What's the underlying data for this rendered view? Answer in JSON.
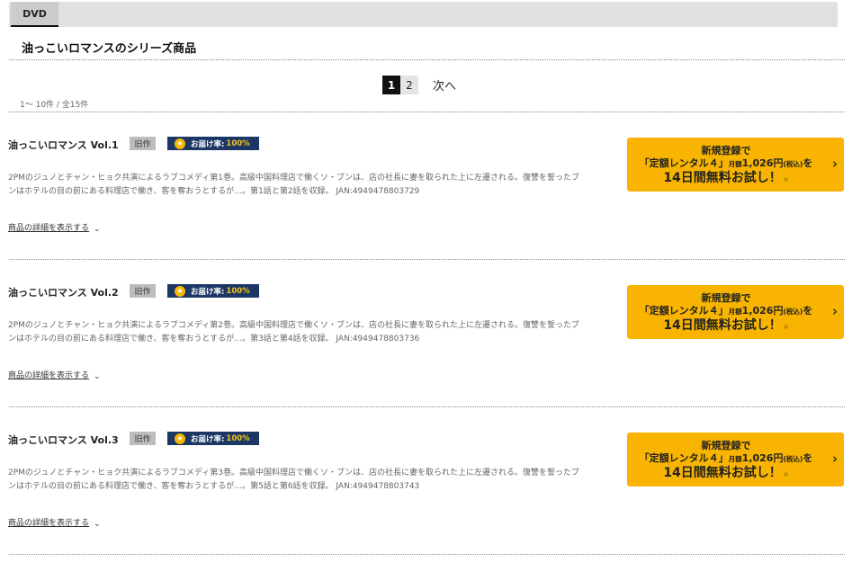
{
  "tabs": [
    {
      "label": "DVD"
    }
  ],
  "series_title": "油っこいロマンスのシリーズ商品",
  "pagination": {
    "pages": [
      "1",
      "2"
    ],
    "current": "1",
    "next_label": "次へ"
  },
  "result_count": "1～ 10件 / 全15件",
  "items": [
    {
      "title": "油っこいロマンス Vol.1",
      "badge_old": "旧作",
      "badge_rate_label": "お届け率:",
      "badge_rate_value": "100%",
      "description_line1": "2PMのジュノとチャン・ヒョク共演によるラブコメディ第1巻。高級中国料理店で働くソ・ブンは、店の社長に妻を取られた上に左遷される。復讐を誓ったブ",
      "description_line2": "ンはホテルの目の前にある料理店で働き、客を奪おうとするが…。第1話と第2話を収録。 JAN:4949478803729",
      "detail_link": "商品の詳細を表示する"
    },
    {
      "title": "油っこいロマンス Vol.2",
      "badge_old": "旧作",
      "badge_rate_label": "お届け率:",
      "badge_rate_value": "100%",
      "description_line1": "2PMのジュノとチャン・ヒョク共演によるラブコメディ第2巻。高級中国料理店で働くソ・ブンは、店の社長に妻を取られた上に左遷される。復讐を誓ったブ",
      "description_line2": "ンはホテルの目の前にある料理店で働き、客を奪おうとするが…。第3話と第4話を収録。 JAN:4949478803736",
      "detail_link": "商品の詳細を表示する"
    },
    {
      "title": "油っこいロマンス Vol.3",
      "badge_old": "旧作",
      "badge_rate_label": "お届け率:",
      "badge_rate_value": "100%",
      "description_line1": "2PMのジュノとチャン・ヒョク共演によるラブコメディ第3巻。高級中国料理店で働くソ・ブンは、店の社長に妻を取られた上に左遷される。復讐を誓ったブ",
      "description_line2": "ンはホテルの目の前にある料理店で働き、客を奪おうとするが…。第5話と第6話を収録。 JAN:4949478803743",
      "detail_link": "商品の詳細を表示する"
    }
  ],
  "cta": {
    "line1": "新規登録で",
    "line2_a": "「定額レンタル４」",
    "line2_small": "月額",
    "line2_price": "1,026円",
    "line2_tax": "(税込)",
    "line2_b": "を",
    "line3": "14日間無料お試し！",
    "note": "※"
  },
  "colors": {
    "cta_bg": "#f8b400",
    "badge_rate_bg": "#1c3766",
    "active_page": "#111111"
  },
  "icons": {
    "cta_arrow": "chevron-right-icon",
    "detail_chevron": "chevron-down-icon",
    "badge_star": "star-icon"
  }
}
